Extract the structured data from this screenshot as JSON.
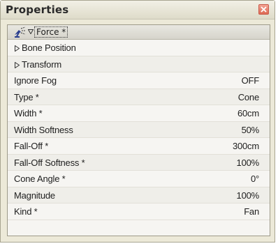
{
  "window": {
    "title": "Properties",
    "close_icon": "close-icon",
    "accent_color": "#e07a66"
  },
  "panel": {
    "object_icon": "force-emitter-icon",
    "expand_icon": "triangle-down-icon",
    "object_label": "Force *"
  },
  "groups": [
    {
      "label": "Bone Position",
      "icon": "triangle-right-icon"
    },
    {
      "label": "Transform",
      "icon": "triangle-right-icon"
    }
  ],
  "properties": [
    {
      "label": "Ignore Fog",
      "value": "OFF"
    },
    {
      "label": "Type *",
      "value": "Cone"
    },
    {
      "label": "Width *",
      "value": "60cm"
    },
    {
      "label": "Width Softness",
      "value": "50%"
    },
    {
      "label": "Fall-Off *",
      "value": "300cm"
    },
    {
      "label": "Fall-Off Softness *",
      "value": "100%"
    },
    {
      "label": "Cone Angle *",
      "value": "0°"
    },
    {
      "label": "Magnitude",
      "value": "100%"
    },
    {
      "label": "Kind *",
      "value": "Fan"
    }
  ]
}
